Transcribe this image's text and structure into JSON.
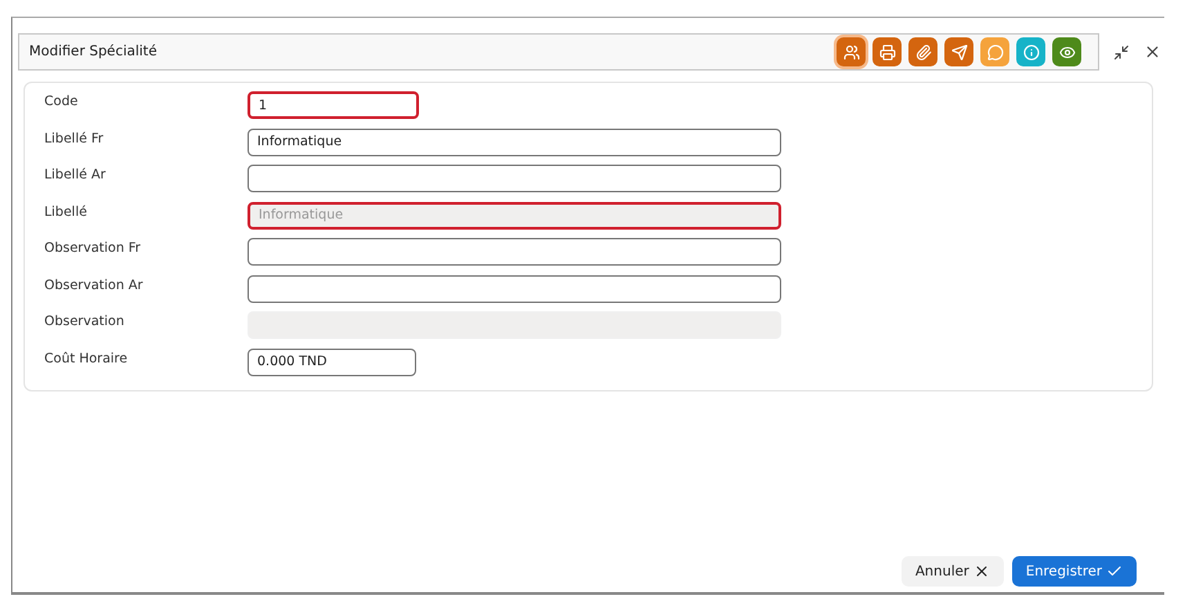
{
  "dialog": {
    "title": "Modifier Spécialité"
  },
  "toolbar": [
    {
      "kind": "people",
      "color": "#d4650f",
      "selected": true
    },
    {
      "kind": "print",
      "color": "#d4650f",
      "selected": false
    },
    {
      "kind": "clip",
      "color": "#d4650f",
      "selected": false
    },
    {
      "kind": "send",
      "color": "#d4650f",
      "selected": false
    },
    {
      "kind": "chat",
      "color": "#f5a33c",
      "selected": false
    },
    {
      "kind": "info",
      "color": "#17b3c8",
      "selected": false
    },
    {
      "kind": "eye",
      "color": "#4e8a1a",
      "selected": false
    }
  ],
  "fields": [
    {
      "label": "Code",
      "kind": "short",
      "value": "1",
      "invalid": true,
      "disabled": false
    },
    {
      "label": "Libellé Fr",
      "kind": "long",
      "value": "Informatique",
      "invalid": false,
      "disabled": false
    },
    {
      "label": "Libellé Ar",
      "kind": "long",
      "invalid": false,
      "disabled": false
    },
    {
      "label": "Libellé",
      "kind": "long",
      "value": "Informatique",
      "invalid": true,
      "disabled": true
    },
    {
      "label": "Observation Fr",
      "kind": "long",
      "invalid": false,
      "disabled": false
    },
    {
      "label": "Observation Ar",
      "kind": "long",
      "invalid": false,
      "disabled": false
    },
    {
      "label": "Observation",
      "kind": "long",
      "invalid": false,
      "disabled": true
    },
    {
      "label": "Coût Horaire",
      "kind": "short",
      "value": "0.000 TND",
      "invalid": false,
      "disabled": false
    }
  ],
  "buttons": [
    {
      "label": "Annuler",
      "kind": "cancel"
    },
    {
      "label": "Enregistrer",
      "kind": "save"
    }
  ]
}
